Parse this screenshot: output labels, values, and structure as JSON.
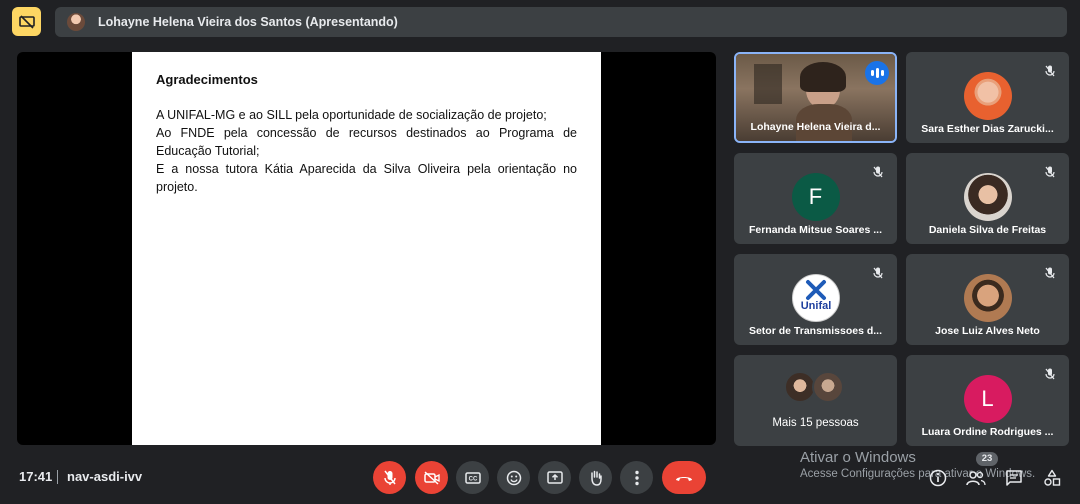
{
  "presenter_bar": {
    "text": "Lohayne Helena Vieira dos Santos (Apresentando)"
  },
  "slide": {
    "title": "Agradecimentos",
    "lines": [
      "A UNIFAL-MG e ao SILL pela oportunidade de socialização de projeto;",
      "Ao FNDE pela concessão de recursos destinados ao Programa de Educação Tutorial;",
      "E a nossa tutora Kátia Aparecida da Silva Oliveira pela orientação no projeto."
    ]
  },
  "tiles": [
    {
      "name": "Lohayne Helena Vieira d...",
      "state": "speaking"
    },
    {
      "name": "Sara Esther Dias Zarucki...",
      "state": "muted"
    },
    {
      "name": "Fernanda Mitsue Soares ...",
      "initial": "F",
      "avatar_color": "#0b5a45",
      "state": "muted"
    },
    {
      "name": "Daniela Silva de Freitas",
      "state": "muted"
    },
    {
      "name": "Setor de Transmissoes d...",
      "logo_text": "Unifal",
      "state": "muted"
    },
    {
      "name": "Jose Luiz Alves Neto",
      "state": "muted"
    },
    {
      "name": "Mais 15 pessoas",
      "state": "group"
    },
    {
      "name": "Luara Ordine Rodrigues ...",
      "initial": "L",
      "avatar_color": "#d81b60",
      "state": "muted"
    }
  ],
  "bottom": {
    "time": "17:41",
    "meeting_code": "nav-asdi-ivv",
    "participants_count": "23"
  },
  "controls": [
    "mic-off-icon",
    "camera-off-icon",
    "captions-icon",
    "emoji-icon",
    "present-icon",
    "raise-hand-icon",
    "more-options-icon",
    "hangup-icon"
  ],
  "watermark": {
    "line1": "Ativar o Windows",
    "line2": "Acesse Configurações para ativar o Windows."
  },
  "colors": {
    "accent": "#8ab4f8",
    "danger": "#ea4335",
    "background": "#202124",
    "surface": "#3c4043"
  }
}
